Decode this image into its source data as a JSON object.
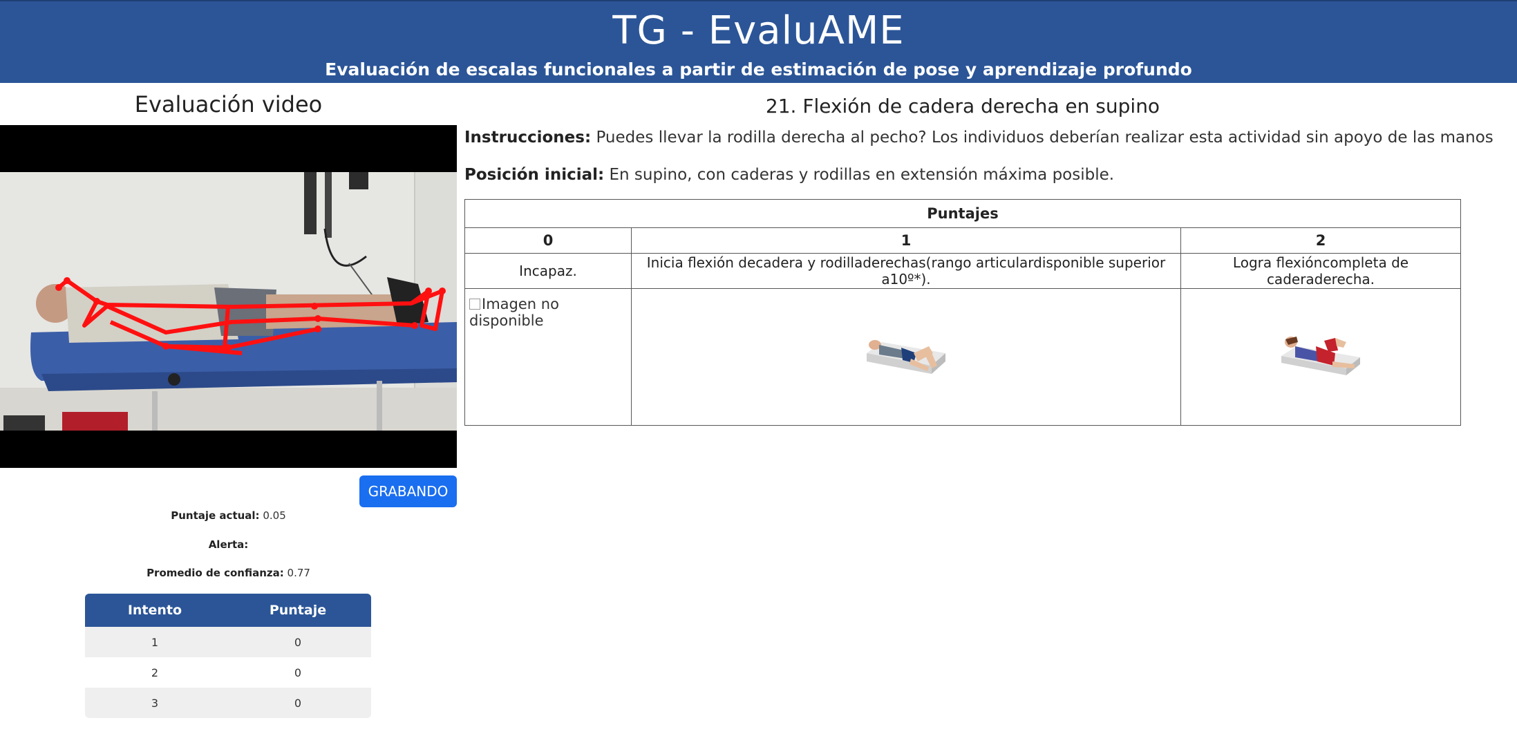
{
  "header": {
    "title": "TG - EvaluAME",
    "subtitle": "Evaluación de escalas funcionales a partir de estimación de pose y aprendizaje profundo",
    "background_color": "#2b5597"
  },
  "video_panel": {
    "heading": "Evaluación video",
    "record_button_label": "GRABANDO",
    "record_button_color": "#1a6ef0",
    "stats": {
      "score_label": "Puntaje actual:",
      "score_value": "0.05",
      "alert_label": "Alerta:",
      "alert_value": "",
      "confidence_label": "Promedio de confianza:",
      "confidence_value": "0.77"
    },
    "attempts": {
      "headers": [
        "Intento",
        "Puntaje"
      ],
      "rows": [
        {
          "attempt": "1",
          "score": "0"
        },
        {
          "attempt": "2",
          "score": "0"
        },
        {
          "attempt": "3",
          "score": "0"
        }
      ]
    }
  },
  "exercise": {
    "title": "21. Flexión de cadera derecha en supino",
    "instructions_label": "Instrucciones:",
    "instructions_text": "Puedes llevar la rodilla derecha al pecho? Los individuos deberían realizar esta actividad sin apoyo de las manos",
    "initial_position_label": "Posición inicial:",
    "initial_position_text": "En supino, con caderas y rodillas en extensión máxima posible.",
    "scores_table": {
      "caption": "Puntajes",
      "columns": [
        "0",
        "1",
        "2"
      ],
      "descriptions": [
        "Incapaz.",
        "Inicia flexión decadera y rodilladerechas(rango articulardisponible superior a10º*).",
        "Logra flexióncompleta de caderaderecha."
      ],
      "image_unavailable_text": "Imagen no disponible"
    }
  }
}
